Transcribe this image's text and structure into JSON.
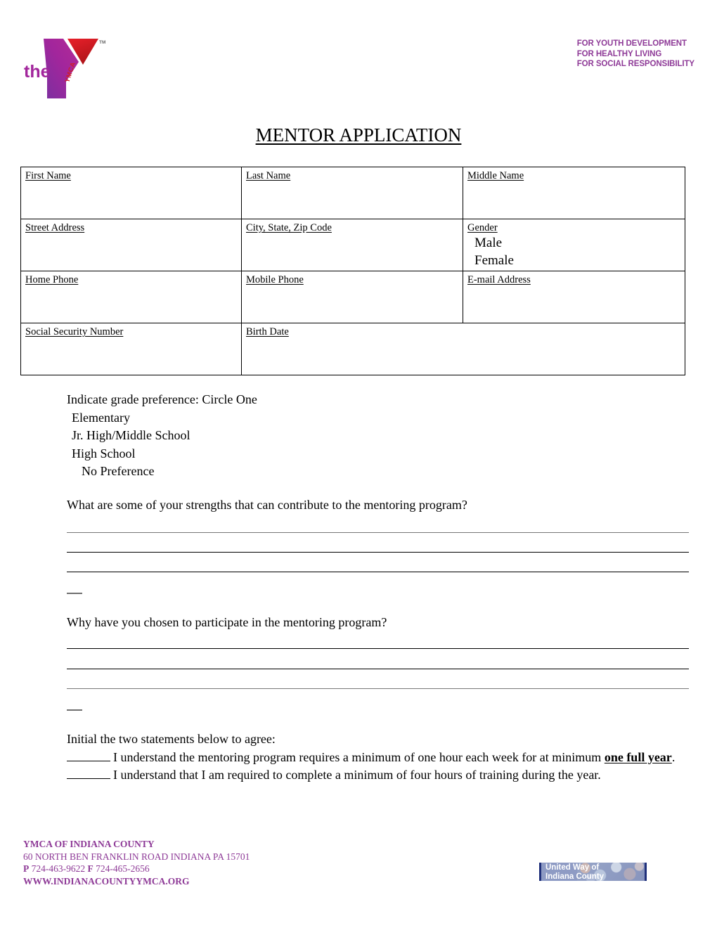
{
  "header": {
    "logo_icon": "ymca-logo",
    "logo_word": "the",
    "logo_mark_text": "YMCA",
    "trademark": "TM",
    "tagline": [
      "FOR YOUTH DEVELOPMENT",
      "FOR HEALTHY LIVING",
      "FOR SOCIAL RESPONSIBILITY"
    ],
    "tagline_color": "#8e3a97"
  },
  "title": "MENTOR APPLICATION",
  "info_table": {
    "rows": [
      {
        "cells": [
          {
            "label": "First Name",
            "value": ""
          },
          {
            "label": "Last Name",
            "value": ""
          },
          {
            "label": "Middle Name",
            "value": ""
          }
        ]
      },
      {
        "cells": [
          {
            "label": "Street Address",
            "value": ""
          },
          {
            "label": "City, State, Zip Code",
            "value": ""
          },
          {
            "label": "Gender",
            "value": "",
            "options": [
              "Male",
              "Female"
            ]
          }
        ]
      },
      {
        "cells": [
          {
            "label": "Home Phone",
            "value": ""
          },
          {
            "label": "Mobile Phone",
            "value": ""
          },
          {
            "label": "E-mail Address",
            "value": ""
          }
        ]
      },
      {
        "cells": [
          {
            "label": "Social Security Number",
            "value": ""
          },
          {
            "label": "Birth Date",
            "value": ""
          }
        ]
      }
    ]
  },
  "grade_preference": {
    "heading": "Indicate grade preference: Circle One",
    "options": [
      "Elementary",
      "Jr. High/Middle School",
      "High School",
      "No Preference"
    ]
  },
  "questions": [
    {
      "prompt": "What are some of your strengths that can contribute to the mentoring program?",
      "answer_lines": 3
    },
    {
      "prompt": "Why have you chosen to participate in the mentoring program?",
      "answer_lines": 3
    }
  ],
  "initial_section": {
    "heading": "Initial the two statements below to agree:",
    "statements": [
      {
        "text_before": "I understand the mentoring program requires a minimum of one hour each week for at minimum ",
        "emphasis": "one full year",
        "text_after": "."
      },
      {
        "text_before": "I understand that I am required to complete a minimum of four hours of training during the year.",
        "emphasis": "",
        "text_after": ""
      }
    ]
  },
  "footer": {
    "org_name": "YMCA OF INDIANA COUNTY",
    "address": "60 NORTH BEN FRANKLIN ROAD INDIANA PA 15701",
    "phone_label": "P",
    "phone": "724-463-9622",
    "fax_label": "F",
    "fax": "724-465-2656",
    "website": "WWW.INDIANACOUNTYYMCA.ORG",
    "color": "#8e3a97",
    "united_way": {
      "line1": "United Way of",
      "line2": "Indiana County"
    }
  }
}
